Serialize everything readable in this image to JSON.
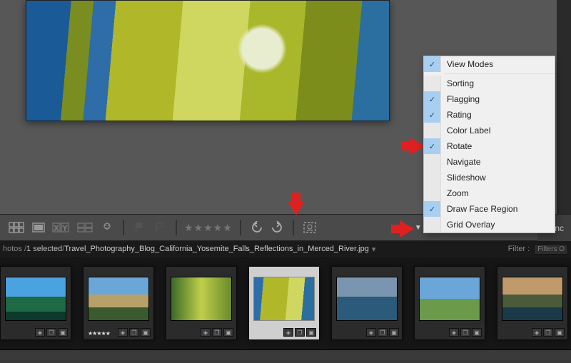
{
  "context_menu": {
    "items": [
      {
        "label": "View Modes",
        "checked": true,
        "sep_after": true
      },
      {
        "label": "Sorting",
        "checked": false
      },
      {
        "label": "Flagging",
        "checked": true
      },
      {
        "label": "Rating",
        "checked": true
      },
      {
        "label": "Color Label",
        "checked": false
      },
      {
        "label": "Rotate",
        "checked": true
      },
      {
        "label": "Navigate",
        "checked": false
      },
      {
        "label": "Slideshow",
        "checked": false
      },
      {
        "label": "Zoom",
        "checked": false
      },
      {
        "label": "Draw Face Region",
        "checked": true
      },
      {
        "label": "Grid Overlay",
        "checked": false
      }
    ]
  },
  "toolbar": {
    "grid_icon": "grid",
    "loupe_icon": "loupe",
    "compare_icon": "compare",
    "survey_icon": "survey",
    "people_icon": "people",
    "flag_icon": "flag",
    "reject_icon": "reject",
    "stars": "★★★★★",
    "rotate_left_icon": "rotate-left",
    "rotate_right_icon": "rotate-right",
    "face_region_icon": "face-region",
    "overflow_icon": "▼",
    "sync_label": "Sync"
  },
  "path_bar": {
    "folder_fragment": "hotos /",
    "selection_text": "1 selected",
    "separator": " /",
    "filename": "Travel_Photography_Blog_California_Yosemite_Falls_Reflections_in_Merced_River.jpg",
    "dropdown_icon": "▾",
    "filter_label": "Filter :",
    "filters_box": "Filters O"
  },
  "filmstrip": {
    "selected_index": 3,
    "stars_thumb_index": 1,
    "thumb_stars": "★★★★★",
    "thumbs": [
      {
        "gradient": "linear-gradient(#4aa3e0 45%, #1d6a44 45% 80%, #0c3a2a 80%)"
      },
      {
        "gradient": "linear-gradient(#6aa6d8 40%, #b8a06a 40% 70%, #3a5a30 70%)"
      },
      {
        "gradient": "linear-gradient(90deg,#3a6a28,#bfcf4a,#6a8a2a)"
      },
      {
        "gradient": "linear-gradient(95deg,#2f6da8 0 15%,#b0b82a 15% 55%,#cfd760 55% 80%,#2a6fa0 80%)"
      },
      {
        "gradient": "linear-gradient(#7a95b0 45%, #2b5a7a 45%)"
      },
      {
        "gradient": "linear-gradient(#6aa6d8 50%, #6a9a4a 50%)"
      },
      {
        "gradient": "linear-gradient(#c09a6a 40%, #4a5a3a 40% 70%, #1a3a4a 70%)"
      }
    ],
    "badge_icons": {
      "tag": "◈",
      "copy": "❐",
      "stack": "▣"
    }
  }
}
